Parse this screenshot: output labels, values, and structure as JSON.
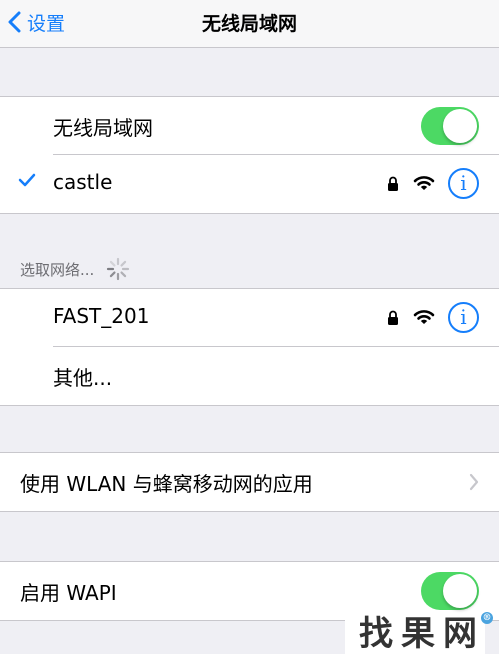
{
  "navbar": {
    "back_label": "设置",
    "title": "无线局域网"
  },
  "wlan_group": {
    "toggle_label": "无线局域网",
    "toggle_on": true,
    "connected_network": "castle",
    "connected_secured": true,
    "info_symbol": "i"
  },
  "network_section": {
    "header": "选取网络...",
    "networks": [
      {
        "name": "FAST_201",
        "secured": true,
        "info_symbol": "i"
      }
    ],
    "other_label": "其他..."
  },
  "app_access": {
    "label": "使用 WLAN 与蜂窝移动网的应用"
  },
  "wapi": {
    "label": "启用 WAPI",
    "toggle_on": true
  },
  "watermark": {
    "text": "找果网",
    "reg_mark": "®"
  },
  "colors": {
    "accent": "#157efb",
    "toggle_on": "#4cd964",
    "background": "#efeff4",
    "separator": "#c8c7cc"
  },
  "icons": [
    "chevron-left-icon",
    "checkmark-icon",
    "lock-icon",
    "wifi-icon",
    "info-icon",
    "spinner-icon",
    "chevron-right-icon"
  ]
}
